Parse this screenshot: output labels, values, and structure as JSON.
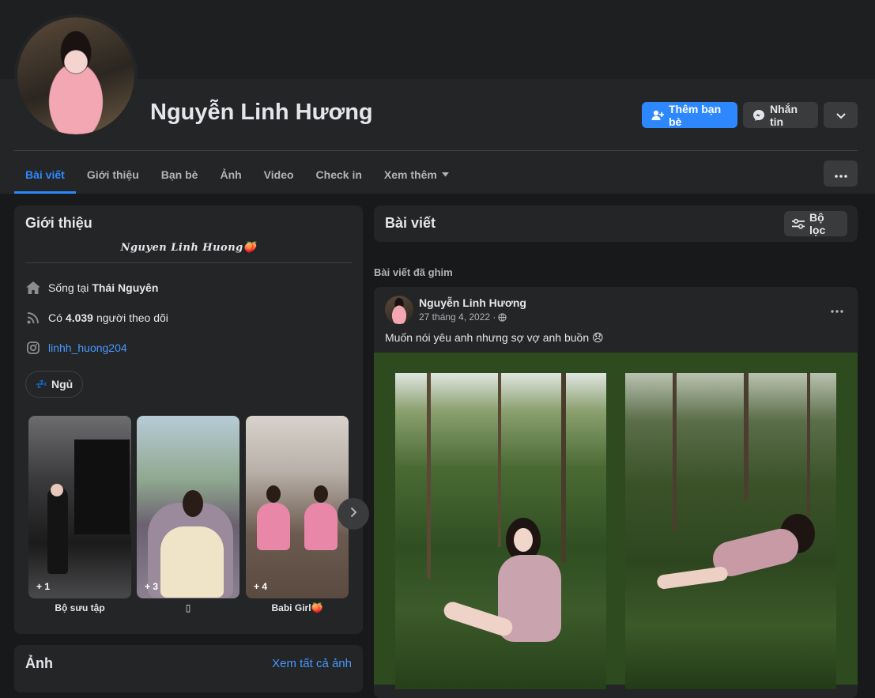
{
  "profile": {
    "name": "Nguyễn Linh Hương"
  },
  "actions": {
    "add_friend": "Thêm bạn bè",
    "message": "Nhắn tin"
  },
  "tabs": [
    {
      "label": "Bài viết"
    },
    {
      "label": "Giới thiệu"
    },
    {
      "label": "Bạn bè"
    },
    {
      "label": "Ảnh"
    },
    {
      "label": "Video"
    },
    {
      "label": "Check in"
    },
    {
      "label": "Xem thêm"
    }
  ],
  "intro": {
    "title": "Giới thiệu",
    "bio": "Nguyen Linh Huong🍑",
    "lives_prefix": "Sống tại",
    "lives_city": "Thái Nguyên",
    "followers_prefix": "Có",
    "followers_count": "4.039",
    "followers_suffix": "người theo dõi",
    "instagram": "linhh_huong204",
    "hobby": "Ngủ",
    "hobby_emoji": "💤"
  },
  "featured": [
    {
      "label": "Bộ sưu tập",
      "count": "+ 1"
    },
    {
      "label": "▯",
      "count": "+ 3"
    },
    {
      "label": "Babi Girl🍑",
      "count": "+ 4"
    }
  ],
  "photos_card": {
    "title": "Ảnh",
    "see_all": "Xem tất cả ảnh"
  },
  "posts_header": {
    "title": "Bài viết",
    "filter": "Bộ lọc"
  },
  "pinned_label": "Bài viết đã ghim",
  "post": {
    "author": "Nguyễn Linh Hương",
    "date": "27 tháng 4, 2022 ·",
    "text": "Muốn nói yêu anh nhưng sợ vợ anh buồn 😞"
  },
  "colors": {
    "accent": "#2d88ff",
    "background": "#18191a",
    "card": "#242526",
    "photo_frame": "#2e4a1f"
  }
}
